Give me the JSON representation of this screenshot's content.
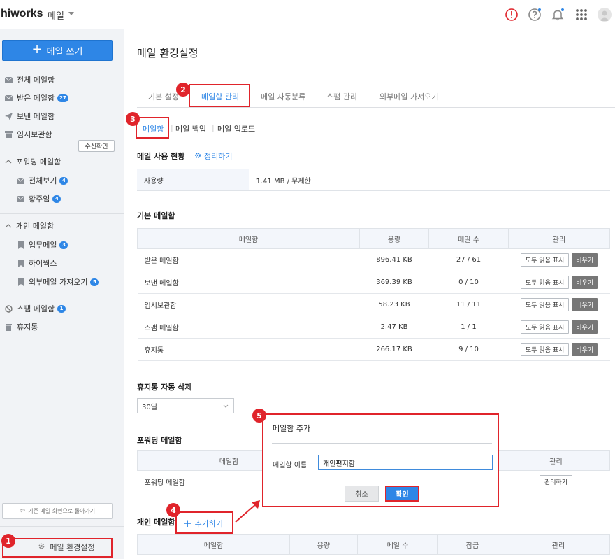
{
  "header": {
    "logo": "hiworks",
    "app_name": "메일",
    "colors": {
      "alert": "#e0242b",
      "accent": "#2e86e6"
    }
  },
  "sidebar": {
    "write_label": "메일 쓰기",
    "items": [
      {
        "label": "전체 메일함",
        "icon": "envelope-icon"
      },
      {
        "label": "받은 메일함",
        "icon": "envelope-icon",
        "badge": "27"
      },
      {
        "label": "보낸 메일함",
        "icon": "paper-plane-icon"
      },
      {
        "label": "임시보관함",
        "icon": "box-icon"
      }
    ],
    "confirm_btn": "수신확인",
    "forward_group": "포워딩 메일함",
    "forward_items": [
      {
        "label": "전체보기",
        "badge": "4"
      },
      {
        "label": "황주임",
        "badge": "4"
      }
    ],
    "personal_group": "개인 메일함",
    "personal_items": [
      {
        "label": "업무메일",
        "badge": "3"
      },
      {
        "label": "하이웍스"
      },
      {
        "label": "외부메일 가져오기",
        "badge": "5"
      }
    ],
    "spam": {
      "label": "스팸 메일함",
      "badge": "1"
    },
    "trash": {
      "label": "휴지통"
    },
    "back_label": "기존 메일 화면으로 돌아가기",
    "settings_label": "메일 환경설정"
  },
  "main": {
    "title": "메일 환경설정",
    "tabs": [
      "기본 설정",
      "메일함 관리",
      "메일 자동분류",
      "스팸 관리",
      "외부메일 가져오기"
    ],
    "subtabs": [
      "메일함",
      "메일 백업",
      "메일 업로드"
    ],
    "usage_title": "메일 사용 현황",
    "tidy_label": "정리하기",
    "usage_label": "사용량",
    "usage_value": "1.41 MB / 무제한",
    "basic_title": "기본 메일함",
    "basic_headers": [
      "메일함",
      "용량",
      "메일 수",
      "관리"
    ],
    "basic_rows": [
      {
        "name": "받은 메일함",
        "size": "896.41 KB",
        "count": "27 / 61"
      },
      {
        "name": "보낸 메일함",
        "size": "369.39 KB",
        "count": "0 / 10"
      },
      {
        "name": "임시보관함",
        "size": "58.23 KB",
        "count": "11 / 11"
      },
      {
        "name": "스팸 메일함",
        "size": "2.47 KB",
        "count": "1 / 1"
      },
      {
        "name": "휴지통",
        "size": "266.17 KB",
        "count": "9 / 10"
      }
    ],
    "btn_read": "모두 읽음 표시",
    "btn_empty": "비우기",
    "trash_auto_title": "휴지통 자동 삭제",
    "trash_auto_value": "30일",
    "forward_title": "포워딩 메일함",
    "forward_headers": [
      "메일함",
      "관리"
    ],
    "forward_row": "포워딩 메일함",
    "forward_manage": "관리하기",
    "personal_title": "개인 메일함",
    "add_label": "추가하기",
    "personal_headers": [
      "메일함",
      "용량",
      "메일 수",
      "잠금",
      "관리"
    ]
  },
  "dialog": {
    "title": "메일함 추가",
    "label": "메일함 이름",
    "value": "개인편지함",
    "cancel": "취소",
    "ok": "확인"
  },
  "callouts": [
    "1",
    "2",
    "3",
    "4",
    "5"
  ]
}
